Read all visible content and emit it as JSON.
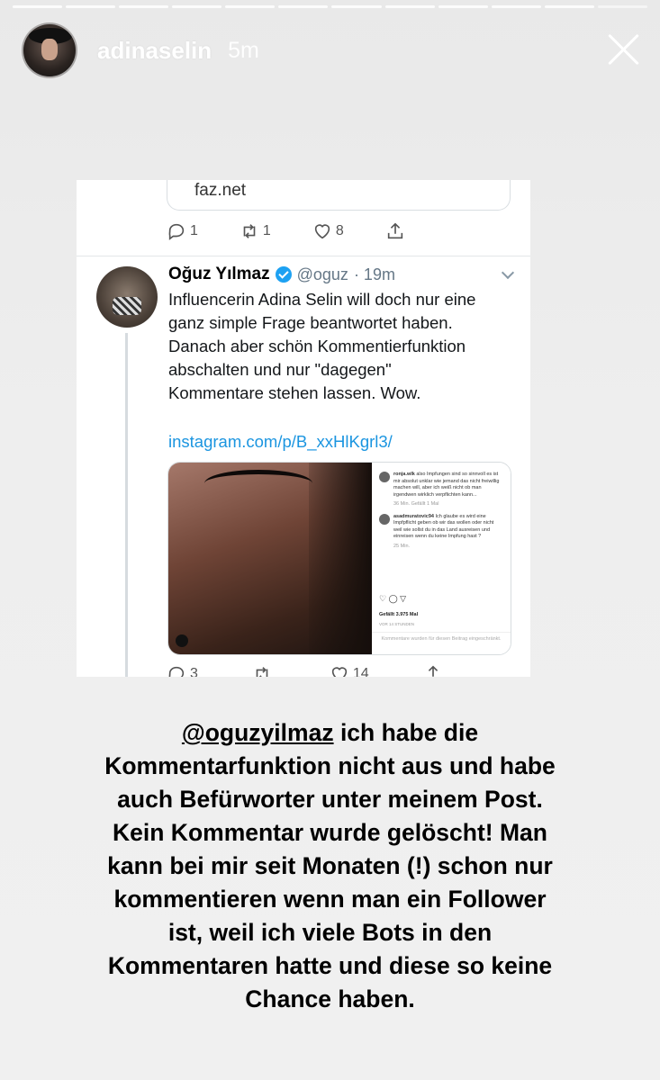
{
  "story": {
    "username": "adinaselin",
    "time_ago": "5m",
    "segments": 12
  },
  "tweet_screenshot": {
    "link_card_text": "faz.net",
    "top_actions": {
      "reply": "1",
      "retweet": "1",
      "like": "8"
    },
    "author_name": "Oğuz Yılmaz",
    "author_handle": "@oguz",
    "tweet_time": "· 19m",
    "tweet_text": "Influencerin Adina Selin will doch nur eine\nganz simple Frage beantwortet haben.\nDanach aber schön Kommentierfunktion\nabschalten und nur \"dagegen\"\nKommentare stehen lassen. Wow.",
    "tweet_link": "instagram.com/p/B_xxHlKgrl3/",
    "embedded_post": {
      "comment1_user": "ronja.wlk",
      "comment1_text": "also Impfungen sind so sinnvoll es ist mir absolut unklar wie jemand das nicht freiwillig machen will, aber ich weiß nicht ob man irgendwen wirklich verpflichten kann...",
      "comment1_meta": "36 Min.  Gefällt 1 Mal",
      "comment2_user": "asadmuratovic94",
      "comment2_text": "Ich glaube es wird eine Impfpflicht geben ob wir das wollen oder nicht weil wie sollst du in das Land ausreisen und einreisen wenn du keine Impfung hast ?",
      "comment2_meta": "25 Min.",
      "likes": "Gefällt 3.975 Mal",
      "time": "VOR 14 STUNDEN",
      "footer": "Kommentare wurden für diesen Beitrag eingeschränkt."
    },
    "bottom_actions": {
      "reply": "3",
      "like": "14"
    }
  },
  "caption": {
    "mention": "@oguzyilmaz",
    "lines": [
      " ich habe die",
      "Kommentarfunktion  nicht aus und habe",
      "auch Befürworter unter meinem Post.",
      "Kein Kommentar wurde gelöscht! Man",
      "kann bei mir seit Monaten (!) schon nur",
      "kommentieren wenn man ein Follower",
      "ist, weil ich viele Bots in den",
      "Kommentaren hatte und diese so keine",
      "Chance haben."
    ]
  },
  "colors": {
    "background": "#eeeeee",
    "twitter_blue": "#1da1f2",
    "link_blue": "#1b95e0"
  }
}
